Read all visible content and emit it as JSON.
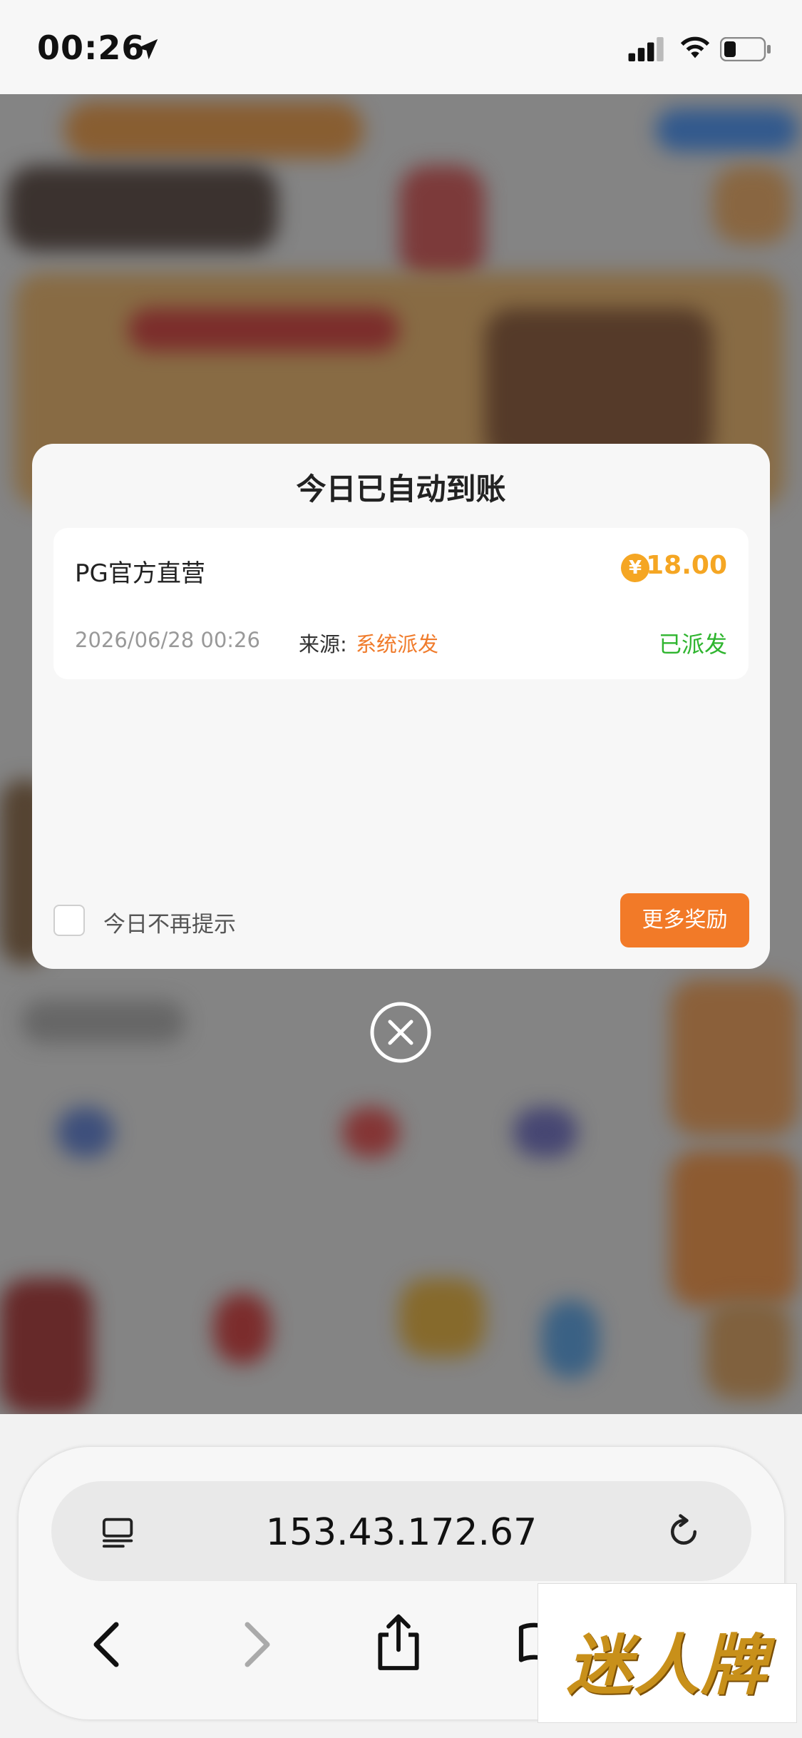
{
  "status_bar": {
    "time": "00:26"
  },
  "dialog": {
    "title": "今日已自动到账",
    "record": {
      "name": "PG官方直营",
      "currency_symbol": "¥",
      "amount": "18.00",
      "datetime": "2026/06/28 00:26",
      "source_label": "来源:",
      "source_value": "系统派发",
      "status": "已派发"
    },
    "dont_remind_label": "今日不再提示",
    "more_rewards_label": "更多奖励"
  },
  "browser": {
    "url": "153.43.172.67"
  },
  "watermark": {
    "text": "迷人牌"
  },
  "colors": {
    "accent_orange": "#f27a28",
    "amount_gold": "#f5a623",
    "status_green": "#2fb52f"
  }
}
